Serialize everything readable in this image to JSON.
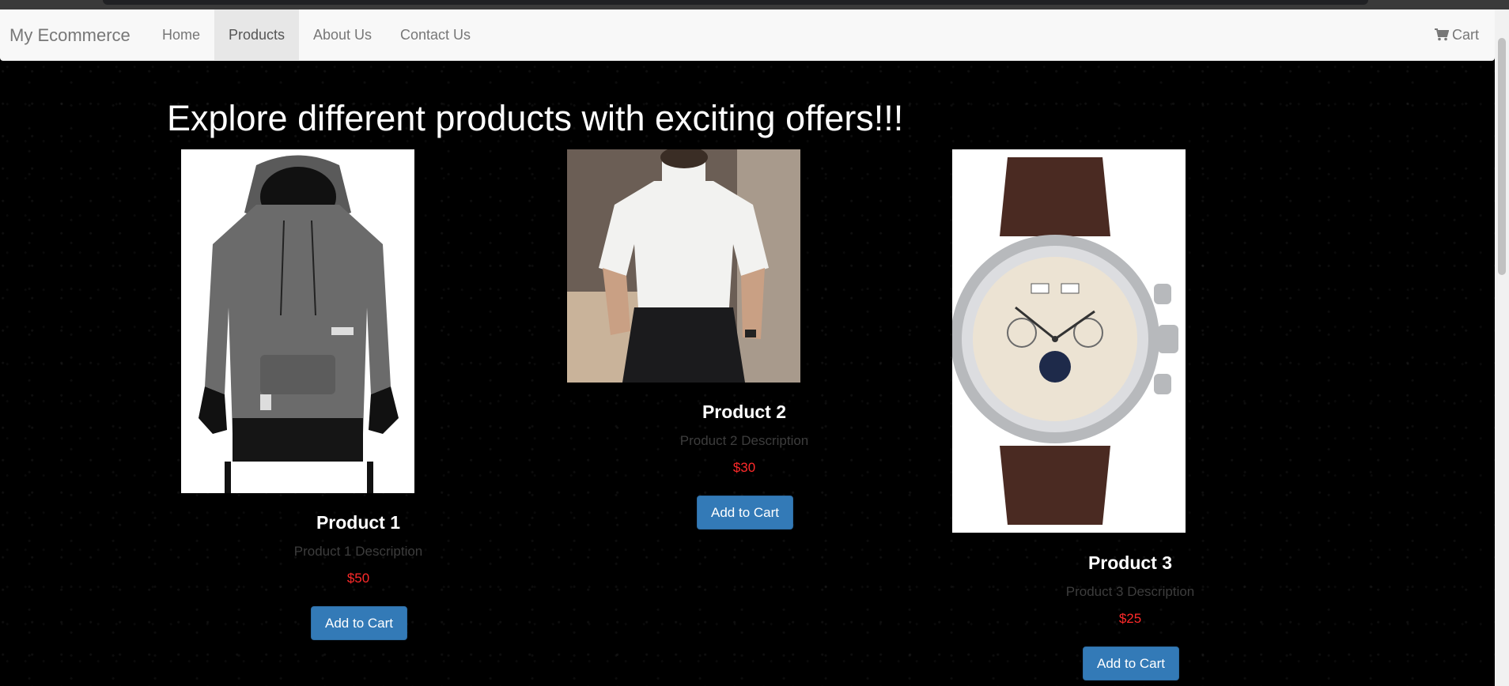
{
  "nav": {
    "brand": "My Ecommerce",
    "items": [
      {
        "label": "Home"
      },
      {
        "label": "Products"
      },
      {
        "label": "About Us"
      },
      {
        "label": "Contact Us"
      }
    ],
    "active": "Products",
    "cart_label": "Cart",
    "cart_icon": "cart-icon"
  },
  "main": {
    "headline": "Explore different products with exciting offers!!!"
  },
  "products": [
    {
      "title": "Product 1",
      "description": "Product 1 Description",
      "price": "$50",
      "button": "Add to Cart",
      "image": "hoodie-image"
    },
    {
      "title": "Product 2",
      "description": "Product 2 Description",
      "price": "$30",
      "button": "Add to Cart",
      "image": "tshirt-image"
    },
    {
      "title": "Product 3",
      "description": "Product 3 Description",
      "price": "$25",
      "button": "Add to Cart",
      "image": "watch-image"
    }
  ],
  "colors": {
    "background": "#000000",
    "navbar": "#f8f8f8",
    "button": "#337ab7",
    "price": "#ff2a2a"
  }
}
